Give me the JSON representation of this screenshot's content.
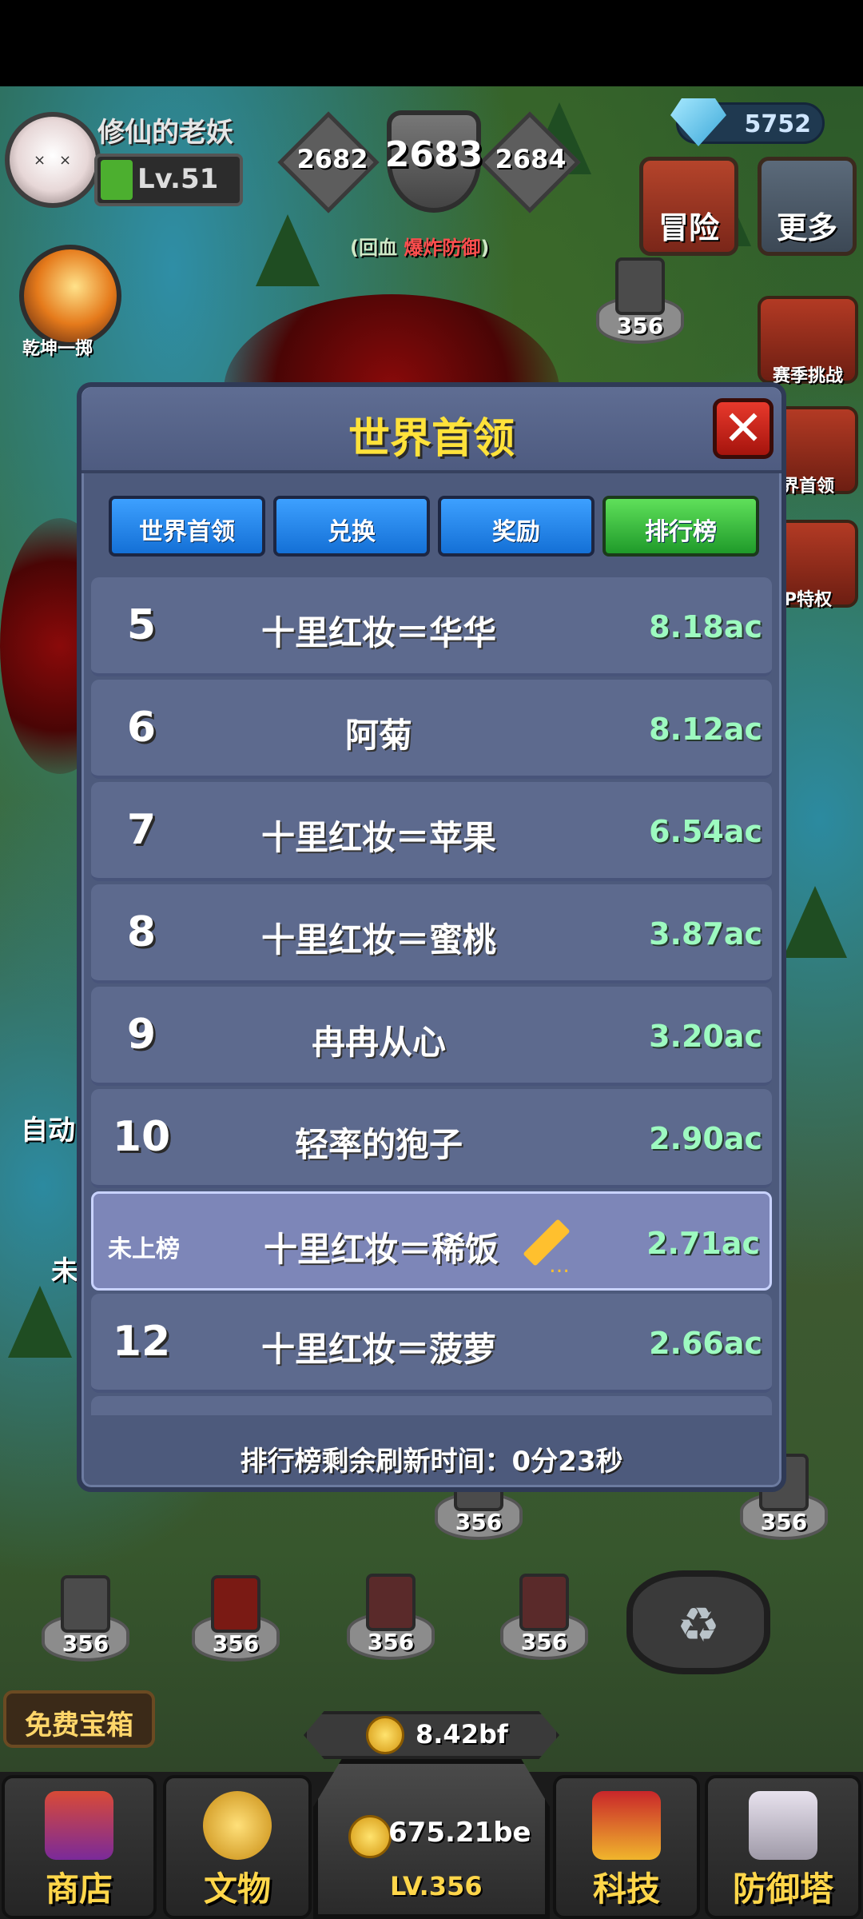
{
  "player": {
    "name": "修仙的老妖",
    "level": "Lv.51"
  },
  "gems": "5752",
  "stages": {
    "prev": "2682",
    "current": "2683",
    "next": "2684"
  },
  "stage_hint": {
    "prefix": "(回血 ",
    "highlight": "爆炸防御",
    "suffix": ")"
  },
  "top_buttons": {
    "adventure": "冒险",
    "more": "更多"
  },
  "skill": {
    "label": "乾坤一掷"
  },
  "side_buttons": [
    "赛季挑战",
    "界首领",
    "P特权"
  ],
  "side_left_labels": [
    "自动",
    "未"
  ],
  "modal": {
    "title": "世界首领",
    "close_icon": "close-icon",
    "tabs": [
      {
        "label": "世界首领",
        "active": false
      },
      {
        "label": "兑换",
        "active": false
      },
      {
        "label": "奖励",
        "active": false
      },
      {
        "label": "排行榜",
        "active": true
      }
    ],
    "rows": [
      {
        "rank": "5",
        "name": "十里红妆＝华华",
        "score": "8.18ac"
      },
      {
        "rank": "6",
        "name": "阿菊",
        "score": "8.12ac"
      },
      {
        "rank": "7",
        "name": "十里红妆＝苹果",
        "score": "6.54ac"
      },
      {
        "rank": "8",
        "name": "十里红妆＝蜜桃",
        "score": "3.87ac"
      },
      {
        "rank": "9",
        "name": "冉冉从心",
        "score": "3.20ac"
      },
      {
        "rank": "10",
        "name": "轻率的狍子",
        "score": "2.90ac"
      },
      {
        "rank": "未上榜",
        "name": "十里红妆＝稀饭",
        "score": "2.71ac",
        "is_self": true
      },
      {
        "rank": "12",
        "name": "十里红妆＝菠萝",
        "score": "2.66ac"
      }
    ],
    "footer": "排行榜剩余刷新时间：0分23秒"
  },
  "towers": [
    "356",
    "356",
    "356",
    "356",
    "356",
    "356",
    "356",
    "356",
    "356"
  ],
  "free_box": "免费宝箱",
  "gold": "8.42bf",
  "center": {
    "amount": "675.21be",
    "level": "LV.356"
  },
  "bottom_tabs": [
    "商店",
    "文物",
    "科技",
    "防御塔"
  ],
  "colors": {
    "title": "#ffe23a",
    "score": "#9dfac0",
    "tab_active": "#2fb83a",
    "tab": "#1f86f0",
    "close": "#d8271c"
  }
}
